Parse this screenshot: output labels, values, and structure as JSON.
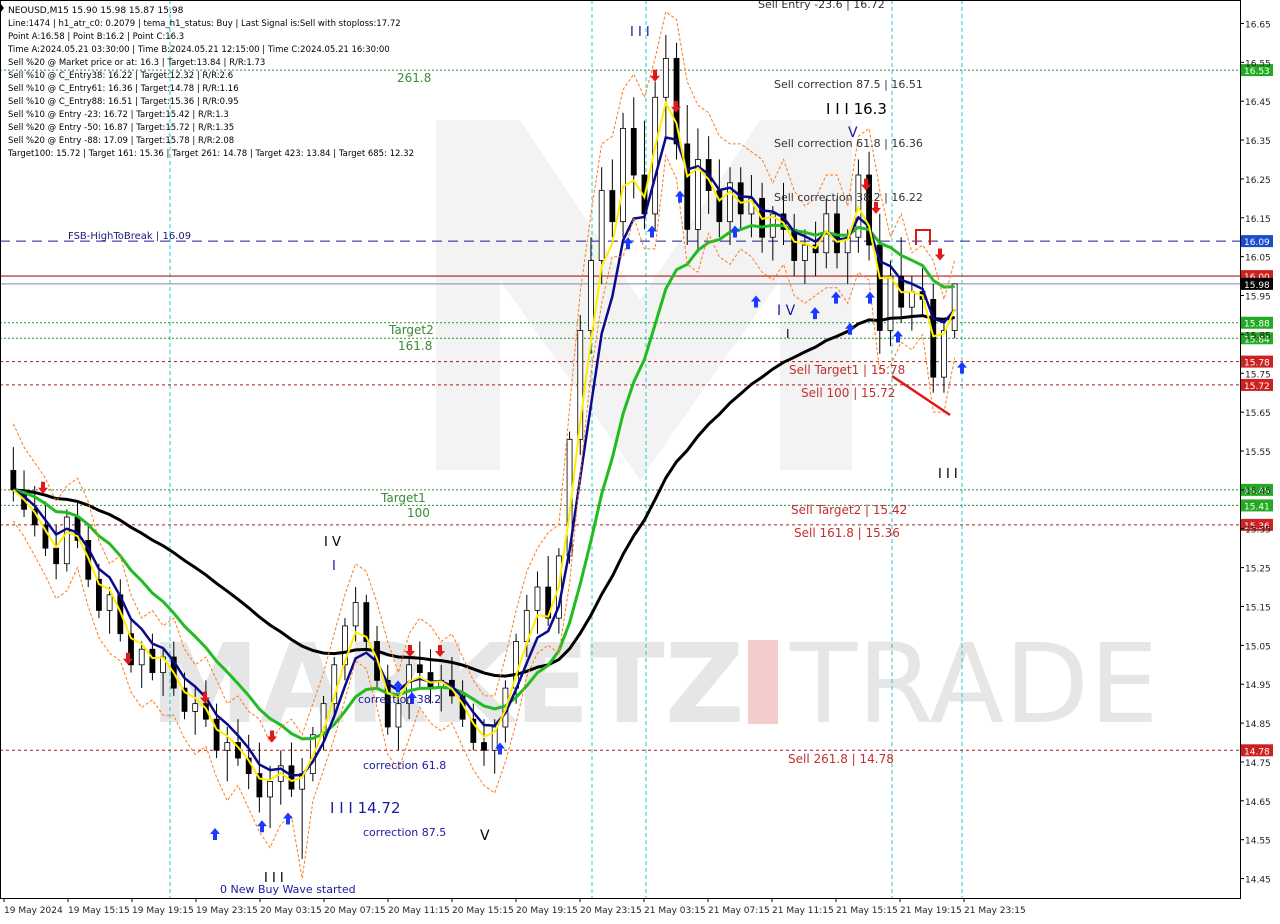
{
  "header": {
    "symbol_line": "NEOUSD,M15  15.90 15.98 15.87 15.98",
    "lines": [
      "Line:1474  |  h1_atr_c0: 0.2079  |  tema_h1_status: Buy  |  Last Signal is:Sell with stoploss:17.72",
      "Point A:16.58  |  Point B:16.2  |  Point C:16.3",
      "Time A:2024.05.21 03:30:00  |  Time B:2024.05.21 12:15:00  |  Time C:2024.05.21 16:30:00",
      "Sell %20 @ Market price or at: 16.3  |  Target:13.84  |  R/R:1.73",
      "Sell %10 @ C_Entry38: 16.22  |  Target:12.32  |  R/R:2.6",
      "Sell %10 @ C_Entry61: 16.36  |  Target:14.78  |  R/R:1.16",
      "Sell %10 @ C_Entry88: 16.51  |  Target:15.36  |  R/R:0.95",
      "Sell %10 @ Entry -23: 16.72  |  Target:15.42  |  R/R:1.3",
      "Sell %20 @ Entry -50: 16.87  |  Target:15.72  |  R/R:1.35",
      "Sell %20 @ Entry -88: 17.09  |  Target:15.78  |  R/R:2.08",
      "Target100: 15.72  |  Target 161: 15.36  |  Target 261: 14.78  |  Target 423: 13.84  |  Target 685: 12.32"
    ]
  },
  "chart_data": {
    "type": "candlestick",
    "symbol": "NEOUSD",
    "timeframe": "M15",
    "ylim": [
      14.4,
      16.7
    ],
    "y_ticks": [
      "16.65",
      "16.55",
      "16.45",
      "16.35",
      "16.25",
      "16.15",
      "16.05",
      "15.95",
      "15.85",
      "15.75",
      "15.65",
      "15.55",
      "15.45",
      "15.35",
      "15.25",
      "15.15",
      "15.05",
      "14.95",
      "14.85",
      "14.75",
      "14.65",
      "14.55",
      "14.45"
    ],
    "x_ticks": [
      "19 May 2024",
      "19 May 15:15",
      "19 May 19:15",
      "19 May 23:15",
      "20 May 03:15",
      "20 May 07:15",
      "20 May 11:15",
      "20 May 15:15",
      "20 May 19:15",
      "20 May 23:15",
      "21 May 03:15",
      "21 May 07:15",
      "21 May 11:15",
      "21 May 15:15",
      "21 May 19:15",
      "21 May 23:15"
    ],
    "candles": [
      [
        15.5,
        15.56,
        15.42,
        15.45
      ],
      [
        15.45,
        15.5,
        15.38,
        15.4
      ],
      [
        15.4,
        15.46,
        15.33,
        15.36
      ],
      [
        15.36,
        15.42,
        15.28,
        15.3
      ],
      [
        15.3,
        15.36,
        15.22,
        15.26
      ],
      [
        15.26,
        15.4,
        15.24,
        15.38
      ],
      [
        15.38,
        15.42,
        15.3,
        15.32
      ],
      [
        15.32,
        15.36,
        15.2,
        15.22
      ],
      [
        15.22,
        15.26,
        15.12,
        15.14
      ],
      [
        15.14,
        15.2,
        15.08,
        15.18
      ],
      [
        15.18,
        15.22,
        15.06,
        15.08
      ],
      [
        15.08,
        15.12,
        14.98,
        15.0
      ],
      [
        15.0,
        15.06,
        14.94,
        15.04
      ],
      [
        15.04,
        15.08,
        14.96,
        14.98
      ],
      [
        14.98,
        15.04,
        14.92,
        15.02
      ],
      [
        15.02,
        15.06,
        14.92,
        14.94
      ],
      [
        14.94,
        14.98,
        14.86,
        14.88
      ],
      [
        14.88,
        14.94,
        14.82,
        14.9
      ],
      [
        14.9,
        14.96,
        14.84,
        14.86
      ],
      [
        14.86,
        14.9,
        14.76,
        14.78
      ],
      [
        14.78,
        14.84,
        14.7,
        14.8
      ],
      [
        14.8,
        14.86,
        14.74,
        14.76
      ],
      [
        14.76,
        14.82,
        14.68,
        14.72
      ],
      [
        14.72,
        14.8,
        14.62,
        14.66
      ],
      [
        14.66,
        14.74,
        14.58,
        14.7
      ],
      [
        14.7,
        14.78,
        14.64,
        14.74
      ],
      [
        14.74,
        14.8,
        14.66,
        14.68
      ],
      [
        14.68,
        14.76,
        14.5,
        14.72
      ],
      [
        14.72,
        14.84,
        14.7,
        14.82
      ],
      [
        14.82,
        14.92,
        14.78,
        14.9
      ],
      [
        14.9,
        15.02,
        14.86,
        15.0
      ],
      [
        15.0,
        15.12,
        14.96,
        15.1
      ],
      [
        15.1,
        15.2,
        15.06,
        15.16
      ],
      [
        15.16,
        15.18,
        15.04,
        15.06
      ],
      [
        15.06,
        15.1,
        14.94,
        14.96
      ],
      [
        14.96,
        15.0,
        14.82,
        14.84
      ],
      [
        14.84,
        14.92,
        14.78,
        14.9
      ],
      [
        14.9,
        15.02,
        14.86,
        15.0
      ],
      [
        15.0,
        15.06,
        14.94,
        14.98
      ],
      [
        14.98,
        15.04,
        14.9,
        14.94
      ],
      [
        14.94,
        15.0,
        14.88,
        14.96
      ],
      [
        14.96,
        15.02,
        14.9,
        14.92
      ],
      [
        14.92,
        14.96,
        14.84,
        14.86
      ],
      [
        14.86,
        14.9,
        14.78,
        14.8
      ],
      [
        14.8,
        14.86,
        14.74,
        14.78
      ],
      [
        14.78,
        14.86,
        14.72,
        14.84
      ],
      [
        14.84,
        14.96,
        14.8,
        14.94
      ],
      [
        14.94,
        15.08,
        14.9,
        15.06
      ],
      [
        15.06,
        15.18,
        15.02,
        15.14
      ],
      [
        15.14,
        15.24,
        15.08,
        15.2
      ],
      [
        15.2,
        15.28,
        15.1,
        15.12
      ],
      [
        15.12,
        15.3,
        15.08,
        15.28
      ],
      [
        15.28,
        15.6,
        15.26,
        15.58
      ],
      [
        15.58,
        15.9,
        15.54,
        15.86
      ],
      [
        15.86,
        16.1,
        15.8,
        16.04
      ],
      [
        16.04,
        16.28,
        15.98,
        16.22
      ],
      [
        16.22,
        16.3,
        16.1,
        16.14
      ],
      [
        16.14,
        16.42,
        16.1,
        16.38
      ],
      [
        16.38,
        16.46,
        16.2,
        16.26
      ],
      [
        16.26,
        16.4,
        16.12,
        16.16
      ],
      [
        16.16,
        16.5,
        16.12,
        16.46
      ],
      [
        16.46,
        16.62,
        16.36,
        16.56
      ],
      [
        16.56,
        16.6,
        16.3,
        16.34
      ],
      [
        16.34,
        16.44,
        16.08,
        16.12
      ],
      [
        16.12,
        16.38,
        16.06,
        16.3
      ],
      [
        16.3,
        16.36,
        16.16,
        16.22
      ],
      [
        16.22,
        16.3,
        16.1,
        16.14
      ],
      [
        16.14,
        16.28,
        16.08,
        16.24
      ],
      [
        16.24,
        16.28,
        16.12,
        16.16
      ],
      [
        16.16,
        16.26,
        16.1,
        16.2
      ],
      [
        16.2,
        16.24,
        16.06,
        16.1
      ],
      [
        16.1,
        16.18,
        16.04,
        16.16
      ],
      [
        16.16,
        16.24,
        16.08,
        16.12
      ],
      [
        16.12,
        16.16,
        16.0,
        16.04
      ],
      [
        16.04,
        16.12,
        15.98,
        16.08
      ],
      [
        16.08,
        16.14,
        16.0,
        16.06
      ],
      [
        16.06,
        16.2,
        16.02,
        16.16
      ],
      [
        16.16,
        16.2,
        16.02,
        16.06
      ],
      [
        16.06,
        16.12,
        15.98,
        16.1
      ],
      [
        16.1,
        16.3,
        16.06,
        16.26
      ],
      [
        16.26,
        16.32,
        16.04,
        16.08
      ],
      [
        16.08,
        16.16,
        15.8,
        15.86
      ],
      [
        15.86,
        16.04,
        15.82,
        16.0
      ],
      [
        16.0,
        16.1,
        15.88,
        15.92
      ],
      [
        15.92,
        16.0,
        15.86,
        15.96
      ],
      [
        15.96,
        16.02,
        15.9,
        15.94
      ],
      [
        15.94,
        15.98,
        15.7,
        15.74
      ],
      [
        15.74,
        15.88,
        15.7,
        15.86
      ],
      [
        15.86,
        15.98,
        15.84,
        15.98
      ]
    ],
    "series": [
      {
        "name": "",
        "color": "#000000",
        "values": []
      },
      {
        "name": "",
        "color": "#22bb22",
        "values": []
      },
      {
        "name": "",
        "color": "#0a0a8a",
        "values": []
      },
      {
        "name": "",
        "color": "#ffee00",
        "values": []
      }
    ],
    "levels": [
      {
        "price": 16.53,
        "label": "16.53",
        "kind": "green"
      },
      {
        "price": 16.09,
        "label": "16.09",
        "kind": "blue"
      },
      {
        "price": 16.0,
        "label": "16.00",
        "kind": "red"
      },
      {
        "price": 15.98,
        "label": "15.98",
        "kind": "current"
      },
      {
        "price": 15.88,
        "label": "15.88",
        "kind": "green"
      },
      {
        "price": 15.84,
        "label": "15.84",
        "kind": "green"
      },
      {
        "price": 15.78,
        "label": "15.78",
        "kind": "red"
      },
      {
        "price": 15.72,
        "label": "15.72",
        "kind": "red"
      },
      {
        "price": 15.45,
        "label": "15.45",
        "kind": "green"
      },
      {
        "price": 15.41,
        "label": "15.41",
        "kind": "green"
      },
      {
        "price": 15.36,
        "label": "15.36",
        "kind": "red"
      },
      {
        "price": 14.78,
        "label": "14.78",
        "kind": "red"
      }
    ],
    "annotations": [
      {
        "text": "Sell Entry -23.6 | 16.72",
        "color": "#333333"
      },
      {
        "text": "261.8",
        "color": "#3a8a3a"
      },
      {
        "text": "Sell correction 87.5 | 16.51",
        "color": "#333333"
      },
      {
        "text": "I I I 16.3",
        "color": "#000000"
      },
      {
        "text": "V",
        "color": "#1a1aa0"
      },
      {
        "text": "Sell correction 61.8 | 16.36",
        "color": "#333333"
      },
      {
        "text": "Sell correction 38.2 | 16.22",
        "color": "#333333"
      },
      {
        "text": "FSB-HighToBreak | 16.09",
        "color": "#1a1a7a"
      },
      {
        "text": "Target2",
        "color": "#3a8a3a"
      },
      {
        "text": "161.8",
        "color": "#3a8a3a"
      },
      {
        "text": "I V",
        "color": "#1a1aa0"
      },
      {
        "text": "I",
        "color": "#000000"
      },
      {
        "text": "Sell Target1 | 15.78",
        "color": "#c03030"
      },
      {
        "text": "Sell 100 | 15.72",
        "color": "#c03030"
      },
      {
        "text": "I I I",
        "color": "#000000"
      },
      {
        "text": "Target1",
        "color": "#3a8a3a"
      },
      {
        "text": "100",
        "color": "#3a8a3a"
      },
      {
        "text": "Sell Target2 | 15.42",
        "color": "#c03030"
      },
      {
        "text": "Sell 161.8 | 15.36",
        "color": "#c03030"
      },
      {
        "text": "I V",
        "color": "#000000"
      },
      {
        "text": "I",
        "color": "#1a1aa0"
      },
      {
        "text": "correction 38.2",
        "color": "#1a1aa0"
      },
      {
        "text": "correction 61.8",
        "color": "#1a1aa0"
      },
      {
        "text": "I I I 14.72",
        "color": "#1a1aa0"
      },
      {
        "text": "correction 87.5",
        "color": "#1a1aa0"
      },
      {
        "text": "V",
        "color": "#000000"
      },
      {
        "text": "I I I",
        "color": "#000000"
      },
      {
        "text": "0 New Buy Wave started",
        "color": "#1a1aa0"
      },
      {
        "text": "Sell 261.8 | 14.78",
        "color": "#c03030"
      },
      {
        "text": "I I I",
        "color": "#1a1aa0"
      }
    ],
    "watermark": "MARKETZITRADE"
  }
}
